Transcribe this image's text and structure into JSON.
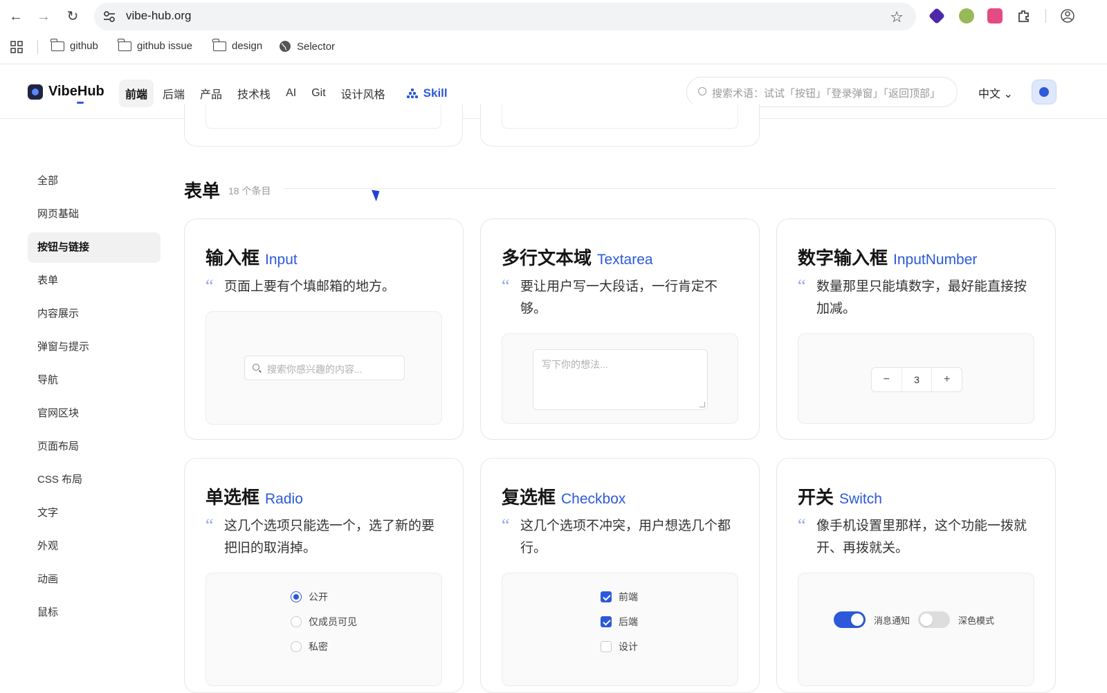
{
  "browser": {
    "url": "vibe-hub.org",
    "bookmarks": [
      "github",
      "github issue",
      "design",
      "Selector"
    ]
  },
  "app": {
    "brand": "VibeHub",
    "nav": [
      "前端",
      "后端",
      "产品",
      "技术栈",
      "AI",
      "Git",
      "设计风格"
    ],
    "skill": "Skill",
    "search_placeholder": "搜索术语：试试「按钮」「登录弹窗」「返回顶部」",
    "language": "中文"
  },
  "sidebar": {
    "items": [
      "全部",
      "网页基础",
      "按钮与链接",
      "表单",
      "内容展示",
      "弹窗与提示",
      "导航",
      "官网区块",
      "页面布局",
      "CSS 布局",
      "文字",
      "外观",
      "动画",
      "鼠标"
    ],
    "active": "按钮与链接"
  },
  "section": {
    "title": "表单",
    "count": "18 个条目"
  },
  "cards": {
    "input": {
      "zh": "输入框",
      "en": "Input",
      "desc": "页面上要有个填邮箱的地方。",
      "placeholder": "搜索你感兴趣的内容..."
    },
    "textarea": {
      "zh": "多行文本域",
      "en": "Textarea",
      "desc": "要让用户写一大段话，一行肯定不够。",
      "placeholder": "写下你的想法..."
    },
    "number": {
      "zh": "数字输入框",
      "en": "InputNumber",
      "desc": "数量那里只能填数字，最好能直接按加减。",
      "value": "3",
      "minus": "−",
      "plus": "+"
    },
    "radio": {
      "zh": "单选框",
      "en": "Radio",
      "desc": "这几个选项只能选一个，选了新的要把旧的取消掉。",
      "options": [
        "公开",
        "仅成员可见",
        "私密"
      ],
      "selected": "公开"
    },
    "checkbox": {
      "zh": "复选框",
      "en": "Checkbox",
      "desc": "这几个选项不冲突，用户想选几个都行。",
      "options": [
        "前端",
        "后端",
        "设计"
      ],
      "checked": [
        "前端",
        "后端"
      ]
    },
    "switch": {
      "zh": "开关",
      "en": "Switch",
      "desc": "像手机设置里那样，这个功能一拨就开、再拨就关。",
      "labels": [
        "消息通知",
        "深色模式"
      ],
      "states": [
        true,
        false
      ]
    }
  },
  "colors": {
    "accent": "#2b59d9",
    "border": "#e6e6e6",
    "muted": "#9a9a9a"
  }
}
